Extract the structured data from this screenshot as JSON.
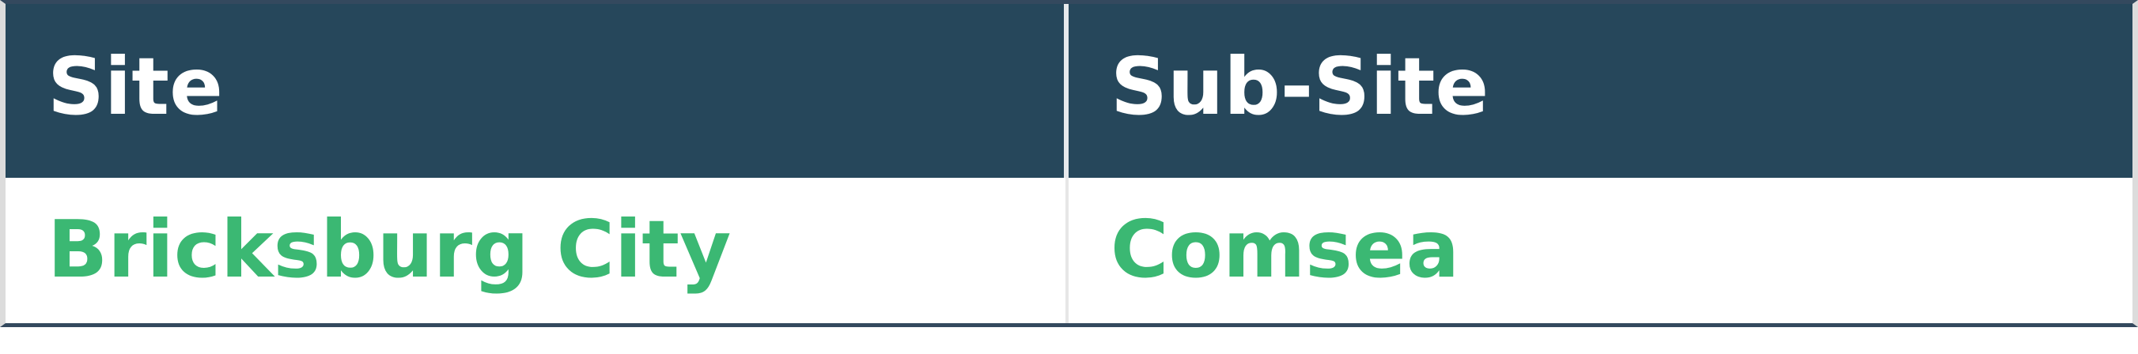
{
  "table": {
    "columns": [
      "Site",
      "Sub-Site"
    ],
    "rows": [
      [
        "Bricksburg City",
        "Comsea"
      ]
    ]
  },
  "colors": {
    "header_bg": "#26475b",
    "header_text": "#ffffff",
    "cell_text": "#3bb873",
    "border_dark": "#34495e",
    "divider": "#e6e6e6"
  }
}
